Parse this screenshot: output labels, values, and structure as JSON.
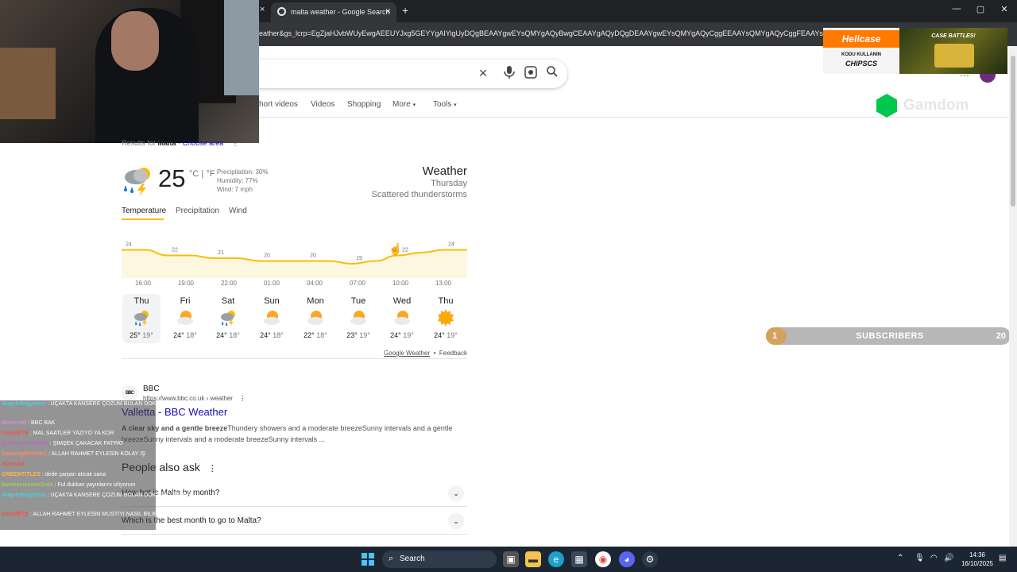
{
  "browser": {
    "tab_title": "malta weather - Google Search",
    "tab_close": "×",
    "new_tab": "+",
    "url": "eather&gs_lcrp=EgZjaHJvbWUyEwgAEEUYJxg5GEYYgAIYigUyDQgBEAAYgwEYsQMYgAQyBwgCEAAYgAQyDQgDEAAYgwEYsQMYgAQyCggEEAAYsQMYgAQyCggFEAAYsQ"
  },
  "search": {
    "clear_icon": "×",
    "tabs": [
      "hort videos",
      "Videos",
      "Shopping",
      "More",
      "Tools"
    ]
  },
  "results_for": {
    "prefix": "Results for",
    "place": "Malta",
    "sep": "·",
    "choose": "Choose area"
  },
  "weather": {
    "temp": "25",
    "units": "°C | °F",
    "precipitation": "Precipitation: 30%",
    "humidity": "Humidity: 77%",
    "wind": "Wind: 7 mph",
    "title": "Weather",
    "day": "Thursday",
    "condition": "Scattered thunderstorms",
    "tabs": [
      "Temperature",
      "Precipitation",
      "Wind"
    ],
    "hourly_times": [
      "16:00",
      "19:00",
      "22:00",
      "01:00",
      "04:00",
      "07:00",
      "10:00",
      "13:00"
    ],
    "footer_source": "Google Weather",
    "footer_sep": "•",
    "footer_feedback": "Feedback",
    "days": [
      {
        "name": "Thu",
        "hi": "25°",
        "lo": "19°",
        "icon": "thunderstorm-icon"
      },
      {
        "name": "Fri",
        "hi": "24°",
        "lo": "18°",
        "icon": "partly-cloudy-icon"
      },
      {
        "name": "Sat",
        "hi": "24°",
        "lo": "18°",
        "icon": "thunderstorm-icon"
      },
      {
        "name": "Sun",
        "hi": "24°",
        "lo": "18°",
        "icon": "partly-cloudy-icon"
      },
      {
        "name": "Mon",
        "hi": "22°",
        "lo": "18°",
        "icon": "partly-cloudy-icon"
      },
      {
        "name": "Tue",
        "hi": "23°",
        "lo": "19°",
        "icon": "partly-cloudy-icon"
      },
      {
        "name": "Wed",
        "hi": "24°",
        "lo": "19°",
        "icon": "partly-cloudy-icon"
      },
      {
        "name": "Thu",
        "hi": "24°",
        "lo": "19°",
        "icon": "sunny-icon"
      }
    ]
  },
  "chart_data": {
    "type": "area",
    "x": [
      "16:00",
      "17:30",
      "19:00",
      "20:30",
      "22:00",
      "23:30",
      "01:00",
      "02:30",
      "04:00",
      "05:30",
      "07:00",
      "08:30",
      "10:00",
      "11:30",
      "13:00",
      "14:30"
    ],
    "values": [
      24,
      24,
      22,
      22,
      21,
      21,
      20,
      20,
      20,
      20,
      19,
      20,
      22,
      23,
      24,
      24
    ],
    "labels": [
      "24",
      "22",
      "21",
      "20",
      "20",
      "19",
      "22",
      "24"
    ],
    "ylim": [
      15,
      27
    ],
    "color": "#fbbc04"
  },
  "bbc": {
    "logo": "BBC",
    "name": "BBC",
    "url": "https://www.bbc.co.uk › weather",
    "title": "Valletta - BBC Weather",
    "snippet_bold": "A clear sky and a gentle breeze",
    "snippet_rest": "Thundery showers and a moderate breezeSunny intervals and a gentle breezeSunny intervals and a moderate breezeSunny intervals ..."
  },
  "people_also_ask": {
    "title": "People also ask",
    "questions": [
      "How hot is Malta by month?",
      "Which is the best month to go to Malta?"
    ]
  },
  "chat": [
    {
      "user": "Angelvleigyetsin",
      "msg": "UÇAKTA KANSERE ÇOZUM BULAN DOKTOR VARMIŞ",
      "color": "#4dd0e1"
    },
    {
      "user": "Mrarestel",
      "msg": "BBC BAK",
      "color": "#ce93d8"
    },
    {
      "user": "onlyMETE",
      "msg": "MAL SAATLER YAZIYO YA KOR",
      "color": "#ef5350"
    },
    {
      "user": "gaimlordsunrelda",
      "msg": "ŞIMŞEK ÇAKACAK PATPAT",
      "color": "#ba68c8"
    },
    {
      "user": "Somengidezbile1",
      "msg": "ALLAH RAHMET EYLESIN KOLAY IŞ",
      "color": "#ff8a65"
    },
    {
      "user": "SDoruk8",
      "msg": "",
      "color": "#ef5350"
    },
    {
      "user": "GREENTITLES",
      "msg": "dede çarpan aticak sana",
      "color": "#ffb74d"
    },
    {
      "user": "bambanicesen3ed4",
      "msg": "Ful dukkan yayınlarını izliyorum",
      "color": "#9ccc65"
    },
    {
      "user": "Angelvleigyetsin",
      "msg": "UÇAKTA KANSERE ÇOZUM BULAN DOKTOR VARMIŞ",
      "color": "#4dd0e1"
    },
    {
      "user": "onlyMETE",
      "msg": "ALLAH RAHMET EYLESIN MUSTIYI NASIL BILIRDINIZ CHAT",
      "color": "#ef5350"
    }
  ],
  "hellcase": {
    "brand": "Hellcase",
    "kodu": "KODU KULLANIN",
    "code": "CHIPSCS",
    "case_battles": "CASE BATTLES!"
  },
  "gamdom": {
    "text": "Gamdom"
  },
  "subscribers": {
    "current": "1",
    "label": "SUBSCRIBERS",
    "goal": "20",
    "progress": 0.05
  },
  "taskbar": {
    "search": "Search",
    "time": "14:36",
    "date": "16/10/2025"
  }
}
